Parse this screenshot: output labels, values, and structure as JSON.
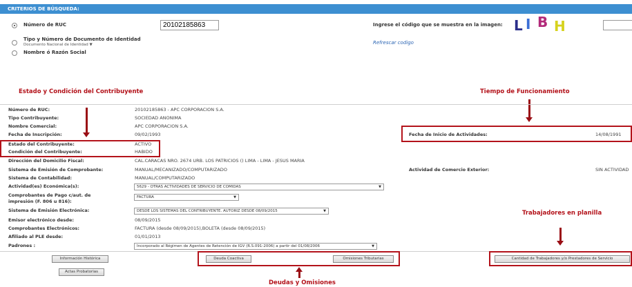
{
  "criteria": {
    "title": "CRITERIOS DE BÚSQUEDA:",
    "option_ruc": "Número de RUC",
    "ruc_value": "20102185863",
    "option_doc": "Tipo y Número de Documento de Identidad",
    "doc_type_select": "Documento Nacional de Identidad",
    "option_name": "Nombre ó Razón Social",
    "captcha_prompt": "Ingrese el código que se muestra en la imagen:",
    "captcha_chars": [
      {
        "char": "L",
        "color": "#2b2f8a"
      },
      {
        "char": "I",
        "color": "#3b6fd6"
      },
      {
        "char": "B",
        "color": "#b22a7a"
      },
      {
        "char": "H",
        "color": "#d6d21e"
      }
    ],
    "refresh_link": "Refrescar codigo"
  },
  "annotations": {
    "estado": "Estado y Condición del Contribuyente",
    "tiempo": "Tiempo de Funcionamiento",
    "trabajadores": "Trabajadores en planilla",
    "deudas": "Deudas y Omisiones"
  },
  "info": {
    "ruc_label": "Número de RUC:",
    "ruc_value": "20102185863 - APC CORPORACION S.A.",
    "tipo_label": "Tipo Contribuyente:",
    "tipo_value": "SOCIEDAD ANONIMA",
    "nombre_label": "Nombre Comercial:",
    "nombre_value": "APC CORPORACION S.A.",
    "fecha_insc_label": "Fecha de Inscripción:",
    "fecha_insc_value": "09/02/1993",
    "fecha_inicio_label": "Fecha de Inicio de Actividades:",
    "fecha_inicio_value": "14/08/1991",
    "estado_label": "Estado del Contribuyente:",
    "estado_value": "ACTIVO",
    "condicion_label": "Condición del Contribuyente:",
    "condicion_value": "HABIDO",
    "direccion_label": "Dirección del Domicilio Fiscal:",
    "direccion_value": "CAL.CARACAS NRO. 2674 URB. LOS PATRICIOS () LIMA - LIMA - JESUS MARIA",
    "emision_label": "Sistema de Emisión de Comprobante:",
    "emision_value": "MANUAL/MECANIZADO/COMPUTARIZADO",
    "comercio_label": "Actividad de Comercio Exterior:",
    "comercio_value": "SIN ACTIVIDAD",
    "contab_label": "Sistema de Contabilidad:",
    "contab_value": "MANUAL/COMPUTARIZADO",
    "actividad_label": "Actividad(es) Económica(s):",
    "actividad_value": "5629 - OTRAS ACTIVIDADES DE SERVICIO DE COMIDAS",
    "comprob_label_1": "Comprobantes de Pago c/aut. de",
    "comprob_label_2": "impresión (F. 806 u 816):",
    "comprob_value": "FACTURA",
    "sist_elec_label": "Sistema de Emisión Electrónica:",
    "sist_elec_value": "DESDE LOS SISTEMAS DEL CONTRIBUYENTE. AUTORIZ DESDE 08/09/2015",
    "emisor_label": "Emisor electrónico desde:",
    "emisor_value": "08/09/2015",
    "comp_elec_label": "Comprobantes Electrónicos:",
    "comp_elec_value": "FACTURA (desde 08/09/2015),BOLETA (desde 08/09/2015)",
    "ple_label": "Afiliado al PLE desde:",
    "ple_value": "01/01/2013",
    "padrones_label": "Padrones :",
    "padrones_value": "Incorporado al Régimen de Agentes de Retención de IGV (R.S.091-2006) a partir del 01/08/2006"
  },
  "buttons": {
    "historica": "Información Histórica",
    "deuda": "Deuda Coactiva",
    "omisiones": "Omisiones Tributarias",
    "trabajadores": "Cantidad de Trabajadores y/o Prestadores de Servicio",
    "actas": "Actas Probatorias"
  }
}
